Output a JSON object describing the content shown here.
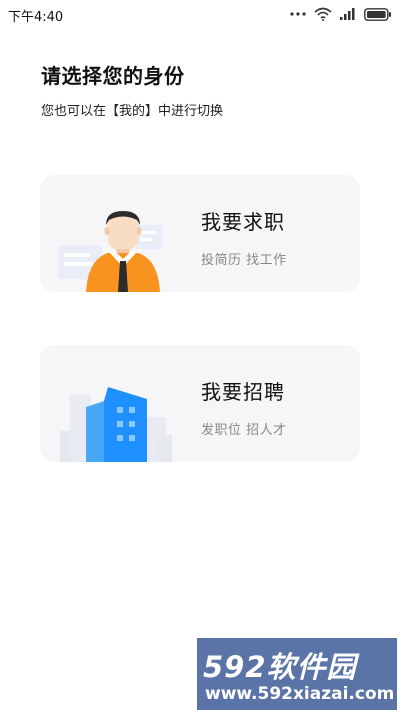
{
  "status_bar": {
    "time": "下午4:40",
    "icons": [
      "more-dots-icon",
      "wifi-icon",
      "signal-icon",
      "battery-icon"
    ]
  },
  "header": {
    "title": "请选择您的身份",
    "subtitle": "您也可以在【我的】中进行切换"
  },
  "options": [
    {
      "title": "我要求职",
      "subtitle": "投简历 找工作",
      "icon": "job-seeker-illustration"
    },
    {
      "title": "我要招聘",
      "subtitle": "发职位 招人才",
      "icon": "recruiter-building-illustration"
    }
  ],
  "watermark": {
    "logo_text": "592软件园",
    "url": "www.592xiazai.com"
  },
  "colors": {
    "card_bg": "#f6f6f9",
    "accent_orange": "#f7931e",
    "accent_blue": "#1e90ff",
    "watermark_bg": "#5b74a8"
  }
}
